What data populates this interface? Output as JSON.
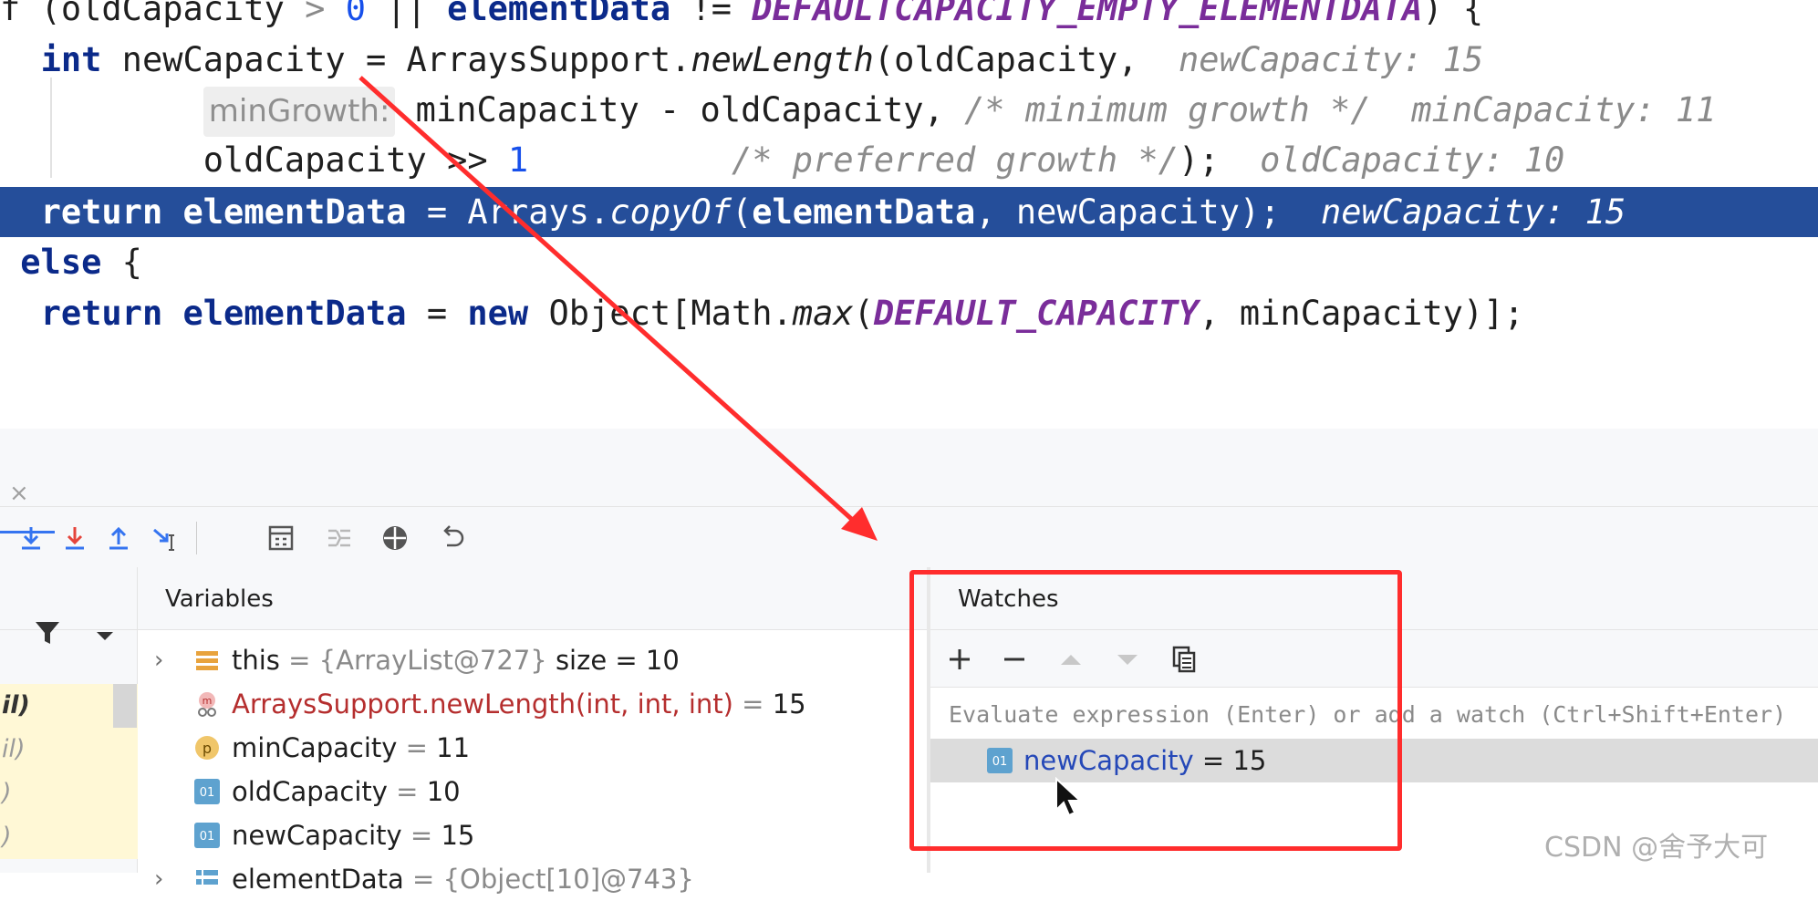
{
  "editor": {
    "lines": [
      {
        "segments": [
          {
            "t": "f (oldCapacity ",
            "c": ""
          },
          {
            "t": ">",
            "c": "gray"
          },
          {
            "t": " ",
            "c": ""
          },
          {
            "t": "0",
            "c": "num"
          },
          {
            "t": " || ",
            "c": ""
          },
          {
            "t": "elementData",
            "c": "kw"
          },
          {
            "t": " != ",
            "c": ""
          },
          {
            "t": "DEFAULTCAPACITY_EMPTY_ELEMENTDATA",
            "c": "cst"
          },
          {
            "t": ") {",
            "c": ""
          }
        ]
      },
      {
        "segments": [
          {
            "t": "  ",
            "c": ""
          },
          {
            "t": "int",
            "c": "kw"
          },
          {
            "t": " newCapacity = ArraysSupport.",
            "c": ""
          },
          {
            "t": "newLength",
            "c": "it"
          },
          {
            "t": "(oldCapacity,  ",
            "c": ""
          },
          {
            "t": "newCapacity: 15",
            "c": "hint"
          }
        ]
      },
      {
        "segments": [
          {
            "t": "          ",
            "c": ""
          },
          {
            "t": "minGrowth:",
            "c": "param-hint"
          },
          {
            "t": " minCapacity - oldCapacity, ",
            "c": ""
          },
          {
            "t": "/* minimum growth */",
            "c": "cmt"
          },
          {
            "t": "  ",
            "c": ""
          },
          {
            "t": "minCapacity: 11",
            "c": "hint"
          }
        ]
      },
      {
        "segments": [
          {
            "t": "          oldCapacity >> ",
            "c": ""
          },
          {
            "t": "1",
            "c": "num"
          },
          {
            "t": "          ",
            "c": ""
          },
          {
            "t": "/* preferred growth */",
            "c": "cmt"
          },
          {
            "t": ");  ",
            "c": ""
          },
          {
            "t": "oldCapacity: 10",
            "c": "hint"
          }
        ]
      },
      {
        "highlight": true,
        "segments": [
          {
            "t": "  ",
            "c": ""
          },
          {
            "t": "return",
            "c": "kw"
          },
          {
            "t": " ",
            "c": ""
          },
          {
            "t": "elementData",
            "c": "kw"
          },
          {
            "t": " = Arrays.",
            "c": ""
          },
          {
            "t": "copyOf",
            "c": "it"
          },
          {
            "t": "(",
            "c": ""
          },
          {
            "t": "elementData",
            "c": "kw"
          },
          {
            "t": ", newCapacity);  ",
            "c": ""
          },
          {
            "t": "newCapacity: 15",
            "c": "hint"
          }
        ]
      },
      {
        "segments": [
          {
            "t": " ",
            "c": ""
          },
          {
            "t": "else",
            "c": "kw"
          },
          {
            "t": " {",
            "c": ""
          }
        ]
      },
      {
        "segments": [
          {
            "t": "  ",
            "c": ""
          },
          {
            "t": "return",
            "c": "kw"
          },
          {
            "t": " ",
            "c": ""
          },
          {
            "t": "elementData",
            "c": "kw"
          },
          {
            "t": " = ",
            "c": ""
          },
          {
            "t": "new",
            "c": "kw"
          },
          {
            "t": " Object[Math.",
            "c": ""
          },
          {
            "t": "max",
            "c": "it"
          },
          {
            "t": "(",
            "c": ""
          },
          {
            "t": "DEFAULT_CAPACITY",
            "c": "cst"
          },
          {
            "t": ", minCapacity)];",
            "c": ""
          }
        ]
      }
    ]
  },
  "debug": {
    "tab_close": "×",
    "frames": [
      "il)",
      "il)",
      ")",
      ")"
    ],
    "variables": {
      "title": "Variables",
      "rows": [
        {
          "arrow": "›",
          "icon": "field-list-icon",
          "name": "this",
          "eq": " = ",
          "value": "{ArrayList@727}",
          "extra": "  size = 10"
        },
        {
          "arrow": "",
          "icon": "method-return-icon",
          "name": "ArraysSupport.newLength(int, int, int)",
          "eq": " = ",
          "value": "15",
          "extra": ""
        },
        {
          "arrow": "",
          "icon": "parameter-icon",
          "name": "minCapacity",
          "eq": " = ",
          "value": "11",
          "extra": ""
        },
        {
          "arrow": "",
          "icon": "primitive-icon",
          "name": "oldCapacity",
          "eq": " = ",
          "value": "10",
          "extra": ""
        },
        {
          "arrow": "",
          "icon": "primitive-icon",
          "name": "newCapacity",
          "eq": " = ",
          "value": "15",
          "extra": ""
        },
        {
          "arrow": "›",
          "icon": "array-icon",
          "name": "elementData",
          "eq": " = ",
          "value": "{Object[10]@743}",
          "extra": ""
        }
      ]
    },
    "watches": {
      "title": "Watches",
      "placeholder": "Evaluate expression (Enter) or add a watch (Ctrl+Shift+Enter)",
      "row": {
        "icon": "primitive-icon",
        "name": "newCapacity",
        "eq": " = ",
        "value": "15"
      }
    }
  },
  "watermark": "CSDN @舍予大可",
  "colors": {
    "annotation": "#ff2d2d",
    "selection": "#254e9a"
  }
}
